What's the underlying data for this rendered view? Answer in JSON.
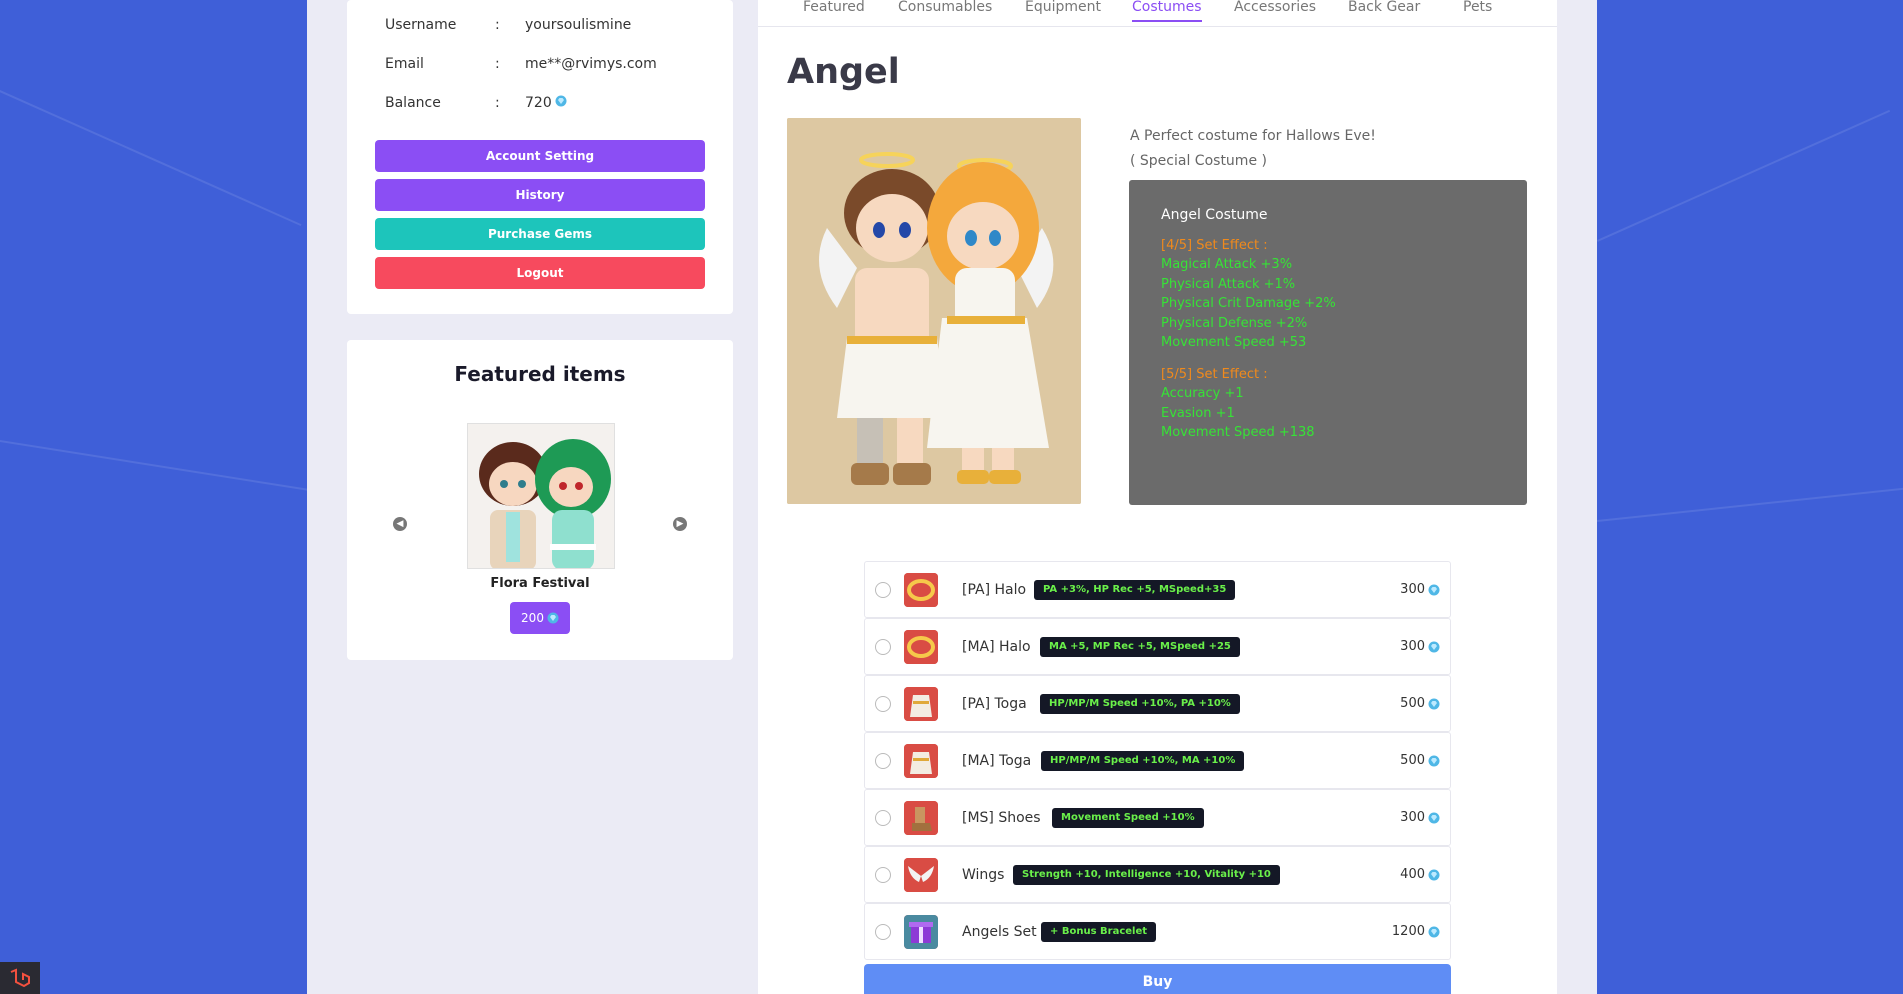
{
  "account": {
    "rows": [
      {
        "key": "Username",
        "sep": ":",
        "value": "yoursoulismine"
      },
      {
        "key": "Email",
        "sep": ":",
        "value": "me**@rvimys.com"
      },
      {
        "key": "Balance",
        "sep": ":",
        "value": "720"
      }
    ],
    "buttons": {
      "account_setting": "Account Setting",
      "history": "History",
      "purchase_gems": "Purchase Gems",
      "logout": "Logout"
    }
  },
  "featured": {
    "title": "Featured items",
    "item_name": "Flora Festival",
    "item_price": "200"
  },
  "tabs": [
    "Featured",
    "Consumables",
    "Equipment",
    "Costumes",
    "Accessories",
    "Back Gear",
    "Pets"
  ],
  "active_tab": "Costumes",
  "product": {
    "title": "Angel",
    "desc_line1": "A Perfect costume for Hallows Eve!",
    "desc_line2": "( Special Costume )",
    "effects_heading": "Angel Costume",
    "set4_label": "[4/5] Set Effect :",
    "set4_stats": [
      "Magical Attack +3%",
      "Physical Attack +1%",
      "Physical Crit Damage +2%",
      "Physical Defense +2%",
      "Movement Speed +53"
    ],
    "set5_label": "[5/5] Set Effect :",
    "set5_stats": [
      "Accuracy +1",
      "Evasion +1",
      "Movement Speed +138"
    ]
  },
  "items": [
    {
      "name": "[PA] Halo",
      "badge": "PA +3%, HP Rec +5, MSpeed+35",
      "price": "300",
      "icon": "halo-icon"
    },
    {
      "name": "[MA] Halo",
      "badge": "MA +5, MP Rec +5, MSpeed +25",
      "price": "300",
      "icon": "halo-icon"
    },
    {
      "name": "[PA] Toga",
      "badge": "HP/MP/M Speed +10%, PA +10%",
      "price": "500",
      "icon": "toga-icon"
    },
    {
      "name": "[MA] Toga",
      "badge": "HP/MP/M Speed +10%, MA +10%",
      "price": "500",
      "icon": "toga-icon"
    },
    {
      "name": "[MS] Shoes",
      "badge": "Movement Speed +10%",
      "price": "300",
      "icon": "shoes-icon"
    },
    {
      "name": "Wings",
      "badge": "Strength +10, Intelligence +10, Vitality +10",
      "price": "400",
      "icon": "wings-icon"
    },
    {
      "name": "Angels Set",
      "badge": "+ Bonus Bracelet",
      "price": "1200",
      "icon": "gift-box-icon"
    }
  ],
  "buy_label": "Buy",
  "colors": {
    "purple": "#8b4ef4",
    "teal": "#1dc5bb",
    "red": "#f74a5e",
    "blue": "#5f8df5",
    "stat_green": "#36e336",
    "set_orange": "#f08a1c"
  }
}
